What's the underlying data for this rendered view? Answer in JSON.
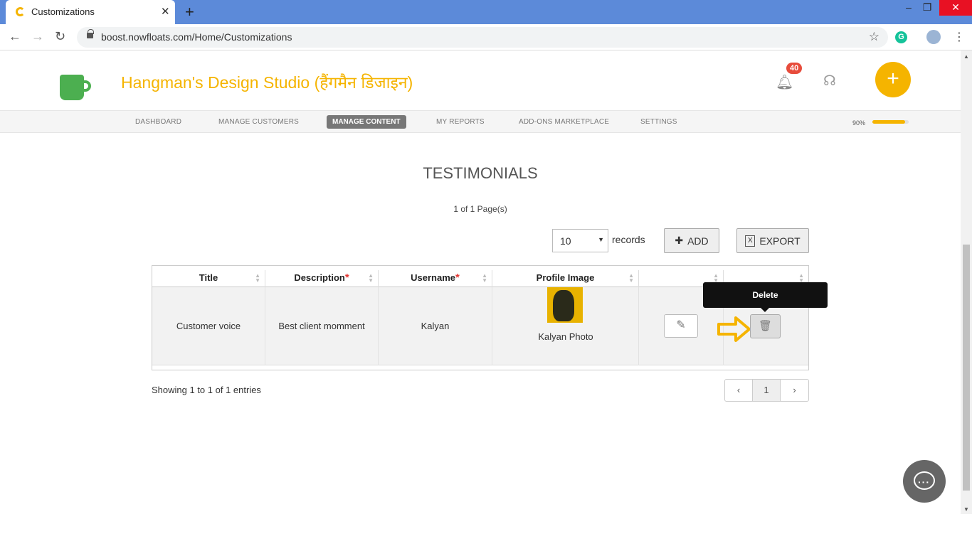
{
  "browser": {
    "tab_title": "Customizations",
    "url": "boost.nowfloats.com/Home/Customizations"
  },
  "header": {
    "brand": "Hangman's Design Studio (हैंगमैन डिजाइन)",
    "notification_count": "40"
  },
  "menu": {
    "items": [
      "DASHBOARD",
      "MANAGE CUSTOMERS",
      "MANAGE CONTENT",
      "MY REPORTS",
      "ADD-ONS MARKETPLACE",
      "SETTINGS"
    ],
    "active": "MANAGE CONTENT",
    "progress_label": "90%",
    "progress_value": 90
  },
  "main": {
    "heading": "TESTIMONIALS",
    "page_info": "1 of 1 Page(s)",
    "records_select": "10",
    "records_label": "records",
    "add_label": "ADD",
    "export_label": "EXPORT",
    "columns": [
      "Title",
      "Description",
      "Username",
      "Profile Image",
      "",
      ""
    ],
    "required_marker": "*",
    "row": {
      "title": "Customer voice",
      "description": "Best client momment",
      "username": "Kalyan",
      "photo_caption": "Kalyan Photo"
    },
    "tooltip": "Delete",
    "showing": "Showing 1 to 1 of 1 entries",
    "pager": [
      "‹",
      "1",
      "›"
    ]
  },
  "colors": {
    "brand": "#f5b400",
    "badge": "#e74c3c",
    "tab_bar": "#5c8ad9"
  }
}
